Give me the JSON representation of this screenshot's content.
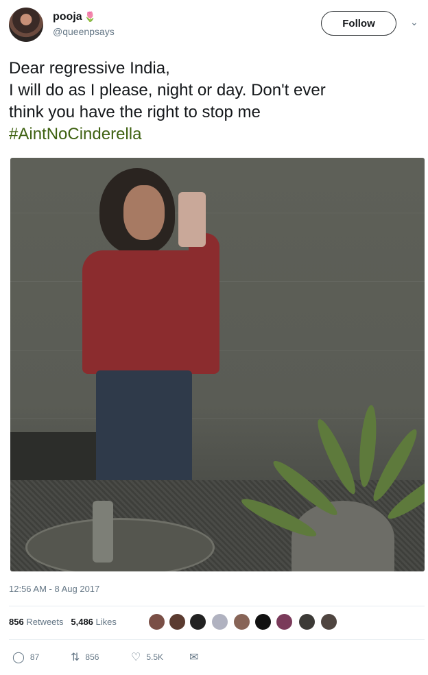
{
  "user": {
    "name": "pooja",
    "handle": "@queenpsays",
    "name_emoji": "🌷"
  },
  "follow_label": "Follow",
  "tweet": {
    "lines": [
      "Dear regressive India,",
      "I will do as I please, night or day. Don't ever",
      "think you have the right to stop me"
    ],
    "hashtag": "#AintNoCinderella"
  },
  "timestamp": "12:56 AM - 8 Aug 2017",
  "stats": {
    "retweets_count": "856",
    "retweets_label": "Retweets",
    "likes_count": "5,486",
    "likes_label": "Likes"
  },
  "actions": {
    "reply_count": "87",
    "retweet_count": "856",
    "like_count": "5.5K"
  },
  "colors": {
    "hashtag": "#3f6212",
    "secondary_text": "#657786",
    "primary_text": "#14171a"
  },
  "icons": [
    "chevron-down-icon",
    "reply-icon",
    "retweet-icon",
    "like-icon",
    "dm-icon"
  ]
}
